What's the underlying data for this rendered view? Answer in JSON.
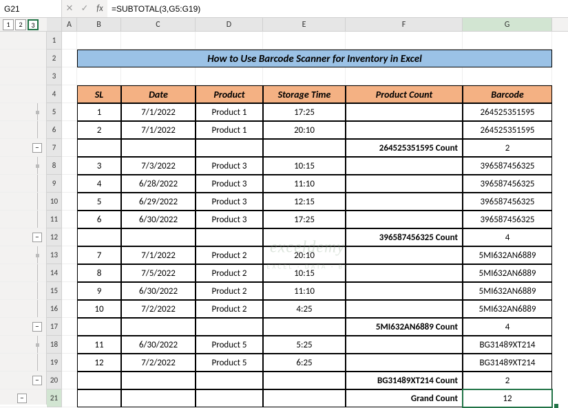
{
  "nameBox": "G21",
  "formulaBar": "=SUBTOTAL(3,G5:G19)",
  "outlineLevels": [
    "1",
    "2",
    "3"
  ],
  "selectedLevel": "3",
  "columns": [
    "A",
    "B",
    "C",
    "D",
    "E",
    "F",
    "G"
  ],
  "title": "How to Use Barcode Scanner for Inventory in Excel",
  "headers": {
    "B": "SL",
    "C": "Date",
    "D": "Product",
    "E": "Storage Time",
    "F": "Product Count",
    "G": "Barcode"
  },
  "rows": [
    {
      "rn": "1",
      "type": "blank"
    },
    {
      "rn": "2",
      "type": "title"
    },
    {
      "rn": "3",
      "type": "blank"
    },
    {
      "rn": "4",
      "type": "header"
    },
    {
      "rn": "5",
      "type": "data",
      "B": "1",
      "C": "7/1/2022",
      "D": "Product 1",
      "E": "17:25",
      "F": "",
      "G": "264525351595",
      "gutter": "bar-dot"
    },
    {
      "rn": "6",
      "type": "data",
      "B": "2",
      "C": "7/1/2022",
      "D": "Product 1",
      "E": "20:10",
      "F": "",
      "G": "264525351595",
      "gutter": "bar"
    },
    {
      "rn": "7",
      "type": "count",
      "F": "264525351595 Count",
      "G": "2",
      "gutter": "minus"
    },
    {
      "rn": "8",
      "type": "data",
      "B": "3",
      "C": "7/3/2022",
      "D": "Product 3",
      "E": "10:15",
      "F": "",
      "G": "396587456325",
      "gutter": "bar-dot"
    },
    {
      "rn": "9",
      "type": "data",
      "B": "4",
      "C": "6/28/2022",
      "D": "Product 3",
      "E": "11:10",
      "F": "",
      "G": "396587456325",
      "gutter": "bar"
    },
    {
      "rn": "10",
      "type": "data",
      "B": "5",
      "C": "6/29/2022",
      "D": "Product 3",
      "E": "12:15",
      "F": "",
      "G": "396587456325",
      "gutter": "bar"
    },
    {
      "rn": "11",
      "type": "data",
      "B": "6",
      "C": "6/30/2022",
      "D": "Product 3",
      "E": "17:25",
      "F": "",
      "G": "396587456325",
      "gutter": "bar"
    },
    {
      "rn": "12",
      "type": "count",
      "F": "396587456325 Count",
      "G": "4",
      "gutter": "minus"
    },
    {
      "rn": "13",
      "type": "data",
      "B": "7",
      "C": "7/1/2022",
      "D": "Product 2",
      "E": "20:10",
      "F": "",
      "G": "5MI632AN6889",
      "gutter": "bar-dot"
    },
    {
      "rn": "14",
      "type": "data",
      "B": "8",
      "C": "7/5/2022",
      "D": "Product 2",
      "E": "10:15",
      "F": "",
      "G": "5MI632AN6889",
      "gutter": "bar"
    },
    {
      "rn": "15",
      "type": "data",
      "B": "9",
      "C": "6/30/2022",
      "D": "Product 2",
      "E": "11:10",
      "F": "",
      "G": "5MI632AN6889",
      "gutter": "bar"
    },
    {
      "rn": "16",
      "type": "data",
      "B": "10",
      "C": "7/2/2022",
      "D": "Product 2",
      "E": "4:25",
      "F": "",
      "G": "5MI632AN6889",
      "gutter": "bar"
    },
    {
      "rn": "17",
      "type": "count",
      "F": "5MI632AN6889 Count",
      "G": "4",
      "gutter": "minus"
    },
    {
      "rn": "18",
      "type": "data",
      "B": "11",
      "C": "6/30/2022",
      "D": "Product 5",
      "E": "5:25",
      "F": "",
      "G": "BG31489XT214",
      "gutter": "bar-dot"
    },
    {
      "rn": "19",
      "type": "data",
      "B": "12",
      "C": "7/2/2022",
      "D": "Product 5",
      "E": "6:25",
      "F": "",
      "G": "BG31489XT214",
      "gutter": "bar"
    },
    {
      "rn": "20",
      "type": "count",
      "F": "BG31489XT214 Count",
      "G": "2",
      "gutter": "minus"
    },
    {
      "rn": "21",
      "type": "grand",
      "F": "Grand Count",
      "G": "12",
      "selected": true,
      "gutter": "minus-outer"
    }
  ],
  "watermark": {
    "main": "exceldemy",
    "sub": "EXCEL · DATA · BI"
  },
  "icons": {
    "dropdown": "▾",
    "cancel": "✕",
    "confirm": "✓",
    "fx": "fx",
    "minus": "−"
  }
}
